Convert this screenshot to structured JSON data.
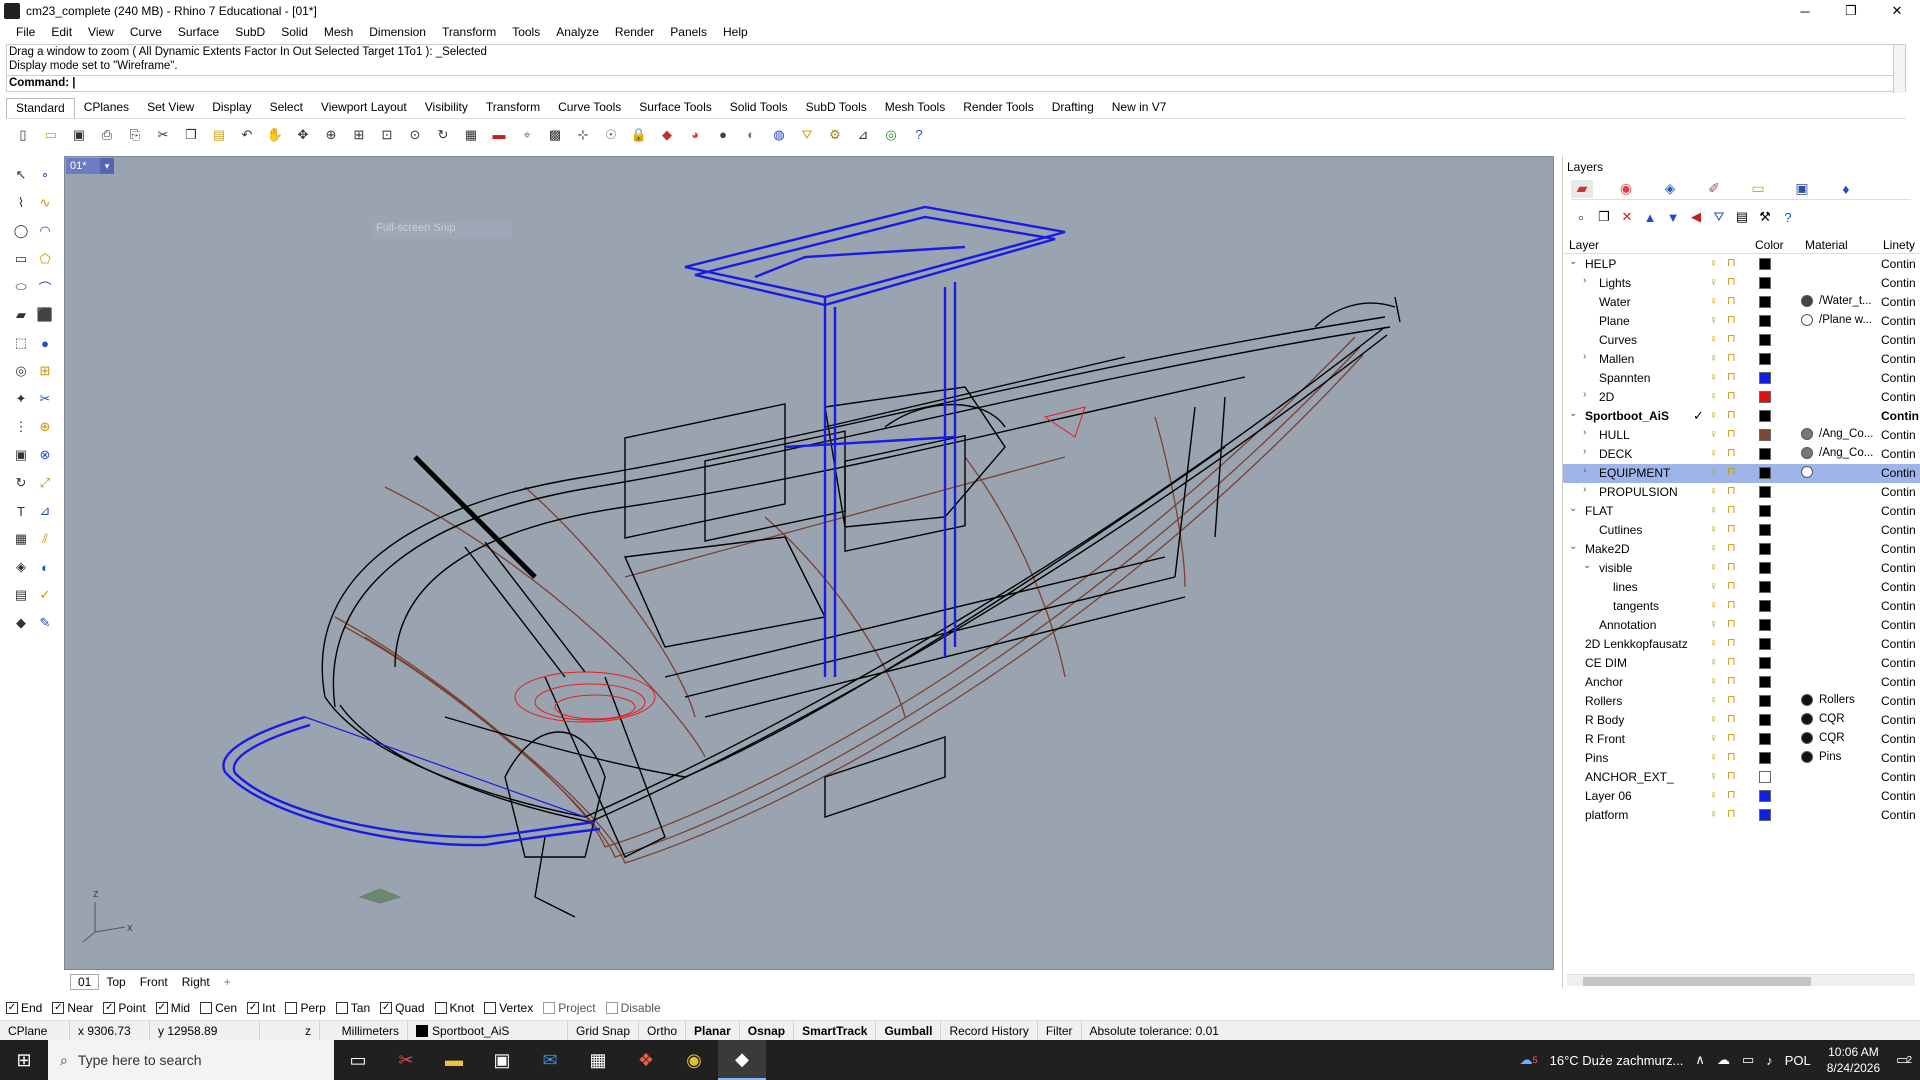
{
  "window": {
    "title": "cm23_complete (240 MB) - Rhino 7 Educational - [01*]",
    "controls": [
      "─",
      "❐",
      "✕"
    ]
  },
  "menu": [
    "File",
    "Edit",
    "View",
    "Curve",
    "Surface",
    "SubD",
    "Solid",
    "Mesh",
    "Dimension",
    "Transform",
    "Tools",
    "Analyze",
    "Render",
    "Panels",
    "Help"
  ],
  "command": {
    "history": [
      "Drag a window to zoom ( All  Dynamic  Extents  Factor  In  Out  Selected  Target  1To1 ): _Selected",
      "Display mode set to \"Wireframe\"."
    ],
    "prompt": "Command:"
  },
  "tabs": [
    "Standard",
    "CPlanes",
    "Set View",
    "Display",
    "Select",
    "Viewport Layout",
    "Visibility",
    "Transform",
    "Curve Tools",
    "Surface Tools",
    "Solid Tools",
    "SubD Tools",
    "Mesh Tools",
    "Render Tools",
    "Drafting",
    "New in V7"
  ],
  "active_tab": "Standard",
  "toolbar_icons": [
    "new-icon",
    "open-icon",
    "save-icon",
    "print-icon",
    "import-icon",
    "cut-icon",
    "copy-icon",
    "paste-icon",
    "undo-icon",
    "pan-icon",
    "move-view-icon",
    "zoom-icon",
    "zoom-window-icon",
    "zoom-extents-icon",
    "zoom-selected-icon",
    "rotate-view-icon",
    "four-views-icon",
    "car-icon",
    "wireframe-icon",
    "grid-icon",
    "select-points-icon",
    "light-icon",
    "lock-icon",
    "shield-icon",
    "color-wheel-icon",
    "sphere-icon",
    "render-sphere-icon",
    "blue-sphere-icon",
    "filter-icon",
    "gear-icon",
    "dimension-icon",
    "globe-icon",
    "help-icon"
  ],
  "viewport": {
    "name": "01*",
    "overlay": "Full-screen Snip",
    "axis_x": "x",
    "axis_z": "z"
  },
  "view_tabs": [
    "01",
    "Top",
    "Front",
    "Right",
    "+"
  ],
  "osnaps": [
    {
      "label": "End",
      "checked": true
    },
    {
      "label": "Near",
      "checked": true
    },
    {
      "label": "Point",
      "checked": true
    },
    {
      "label": "Mid",
      "checked": true
    },
    {
      "label": "Cen",
      "checked": false
    },
    {
      "label": "Int",
      "checked": true
    },
    {
      "label": "Perp",
      "checked": false
    },
    {
      "label": "Tan",
      "checked": false
    },
    {
      "label": "Quad",
      "checked": true
    },
    {
      "label": "Knot",
      "checked": false
    },
    {
      "label": "Vertex",
      "checked": false
    },
    {
      "label": "Project",
      "checked": false
    },
    {
      "label": "Disable",
      "checked": false
    }
  ],
  "status": {
    "cplane": "CPlane",
    "x": "x 9306.73",
    "y": "y 12958.89",
    "z": "z",
    "units": "Millimeters",
    "layer": "Sportboot_AiS",
    "toggles": [
      "Grid Snap",
      "Ortho",
      "Planar",
      "Osnap",
      "SmartTrack",
      "Gumball",
      "Record History",
      "Filter"
    ],
    "tolerance": "Absolute tolerance: 0.01"
  },
  "taskbar": {
    "search_placeholder": "Type here to search",
    "weather": "16°C  Duże zachmurz...",
    "lang": "POL",
    "time": "10:06 AM",
    "date": "8/24/2026",
    "badge": "5",
    "notif_count": "2"
  },
  "layers": {
    "title": "Layers",
    "headers": {
      "layer": "Layer",
      "color": "Color",
      "material": "Material",
      "linetype": "Linety"
    },
    "rows": [
      {
        "name": "HELP",
        "indent": 0,
        "expand": "⌄",
        "color": "#000000",
        "lt": "Contin"
      },
      {
        "name": "Lights",
        "indent": 1,
        "expand": "›",
        "color": "#000000",
        "lt": "Contin"
      },
      {
        "name": "Water",
        "indent": 1,
        "expand": "",
        "color": "#000000",
        "mat": "#444444",
        "matname": "/Water_t...",
        "lt": "Contin"
      },
      {
        "name": "Plane",
        "indent": 1,
        "expand": "",
        "color": "#000000",
        "mat": "#ffffff",
        "matname": "/Plane w...",
        "lt": "Contin"
      },
      {
        "name": "Curves",
        "indent": 1,
        "expand": "",
        "color": "#000000",
        "lt": "Contin"
      },
      {
        "name": "Mallen",
        "indent": 1,
        "expand": "›",
        "color": "#000000",
        "lt": "Contin"
      },
      {
        "name": "Spannten",
        "indent": 1,
        "expand": "",
        "color": "#1020e0",
        "lt": "Contin"
      },
      {
        "name": "2D",
        "indent": 1,
        "expand": "›",
        "color": "#e01010",
        "lt": "Contin"
      },
      {
        "name": "Sportboot_AiS",
        "indent": 0,
        "expand": "⌄",
        "color": "#000000",
        "lt": "Contin",
        "bold": true,
        "current": true
      },
      {
        "name": "HULL",
        "indent": 1,
        "expand": "›",
        "color": "#7a4a34",
        "mat": "#777777",
        "matname": "/Ang_Co...",
        "lt": "Contin"
      },
      {
        "name": "DECK",
        "indent": 1,
        "expand": "›",
        "color": "#000000",
        "mat": "#777777",
        "matname": "/Ang_Co...",
        "lt": "Contin"
      },
      {
        "name": "EQUIPMENT",
        "indent": 1,
        "expand": "›",
        "color": "#000000",
        "mat": "#ffffff",
        "matname": "",
        "lt": "Contin",
        "selected": true
      },
      {
        "name": "PROPULSION",
        "indent": 1,
        "expand": "›",
        "color": "#000000",
        "lt": "Contin"
      },
      {
        "name": "FLAT",
        "indent": 0,
        "expand": "⌄",
        "color": "#000000",
        "lt": "Contin"
      },
      {
        "name": "Cutlines",
        "indent": 1,
        "expand": "",
        "color": "#000000",
        "lt": "Contin"
      },
      {
        "name": "Make2D",
        "indent": 0,
        "expand": "⌄",
        "color": "#000000",
        "lt": "Contin"
      },
      {
        "name": "visible",
        "indent": 1,
        "expand": "⌄",
        "color": "#000000",
        "lt": "Contin"
      },
      {
        "name": "lines",
        "indent": 2,
        "expand": "",
        "color": "#000000",
        "lt": "Contin"
      },
      {
        "name": "tangents",
        "indent": 2,
        "expand": "",
        "color": "#000000",
        "lt": "Contin"
      },
      {
        "name": "Annotation",
        "indent": 1,
        "expand": "",
        "color": "#000000",
        "lt": "Contin"
      },
      {
        "name": "2D Lenkkopfausatz",
        "indent": 0,
        "expand": "",
        "color": "#000000",
        "lt": "Contin"
      },
      {
        "name": "CE DIM",
        "indent": 0,
        "expand": "",
        "color": "#000000",
        "lt": "Contin"
      },
      {
        "name": "Anchor",
        "indent": 0,
        "expand": "",
        "color": "#000000",
        "lt": "Contin"
      },
      {
        "name": "Rollers",
        "indent": 0,
        "expand": "",
        "color": "#000000",
        "mat": "#111111",
        "matname": "Rollers",
        "lt": "Contin"
      },
      {
        "name": "R Body",
        "indent": 0,
        "expand": "",
        "color": "#000000",
        "mat": "#111111",
        "matname": "CQR",
        "lt": "Contin"
      },
      {
        "name": "R Front",
        "indent": 0,
        "expand": "",
        "color": "#000000",
        "mat": "#111111",
        "matname": "CQR",
        "lt": "Contin"
      },
      {
        "name": "Pins",
        "indent": 0,
        "expand": "",
        "color": "#000000",
        "mat": "#111111",
        "matname": "Pins",
        "lt": "Contin"
      },
      {
        "name": "ANCHOR_EXT_",
        "indent": 0,
        "expand": "",
        "color": "#ffffff",
        "lt": "Contin"
      },
      {
        "name": "Layer 06",
        "indent": 0,
        "expand": "",
        "color": "#1020e0",
        "lt": "Contin"
      },
      {
        "name": "platform",
        "indent": 0,
        "expand": "",
        "color": "#1020e0",
        "lt": "Contin"
      }
    ]
  }
}
